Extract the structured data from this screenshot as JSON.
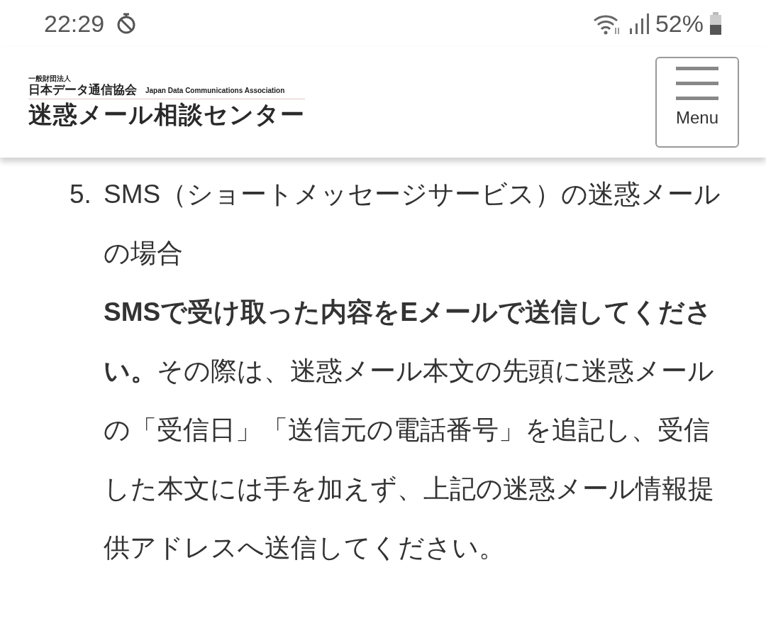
{
  "status_bar": {
    "time": "22:29",
    "battery": "52%"
  },
  "header": {
    "logo": {
      "org_type": "一般財団法人",
      "org_name": "日本データ通信協会",
      "org_name_en": "Japan Data Communications Association",
      "center_name": "迷惑メール相談センター"
    },
    "menu_button": {
      "label": "Menu"
    }
  },
  "list_items": [
    {
      "number": "5.",
      "heading": "SMS（ショートメッセージサービス）の迷惑メールの場合",
      "body": "**SMSで受け取った内容をEメールで送信してください。**その際は、迷惑メール本文の先頭に迷惑メールの「受信日」「送信元の電話番号」を追記し、受信した本文には手を加えず、上記の迷惑メール情報提供アドレスへ送信してください。"
    }
  ]
}
